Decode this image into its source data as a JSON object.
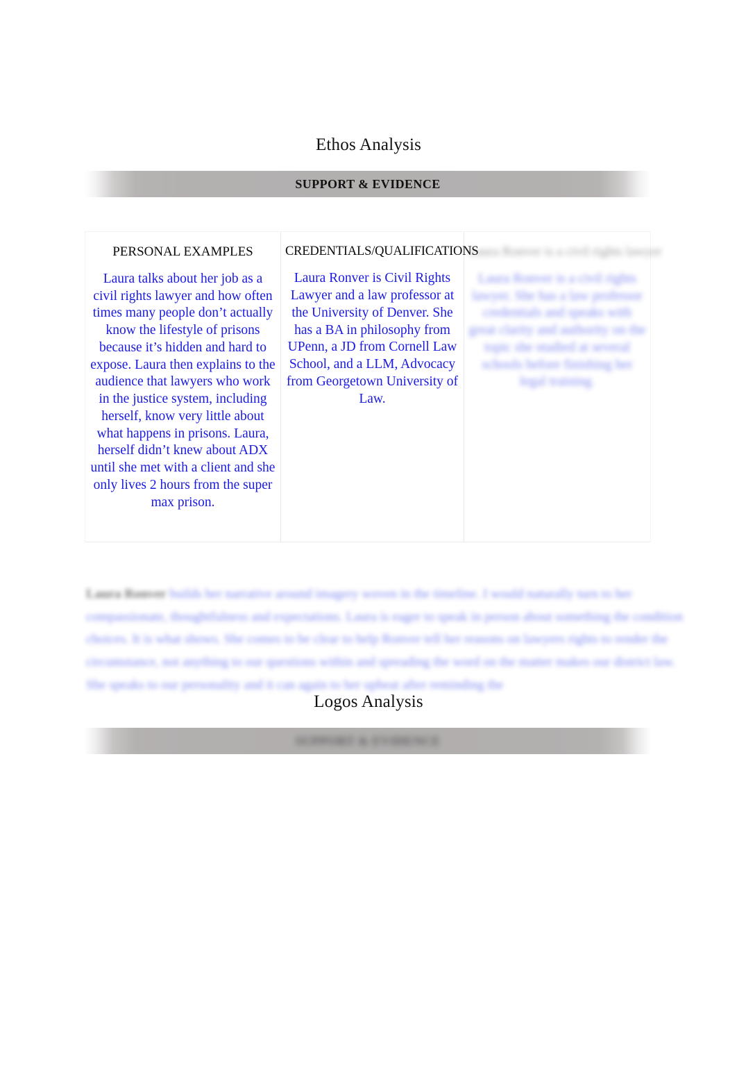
{
  "document": {
    "sections": [
      {
        "id": "ethos",
        "heading": "Ethos Analysis"
      },
      {
        "id": "logos",
        "heading": "Logos Analysis"
      }
    ]
  },
  "banners": {
    "top": {
      "label": "SUPPORT & EVIDENCE"
    },
    "bottom": {
      "label": "SUPPORT & EVIDENCE"
    }
  },
  "evidence_table": {
    "columns": [
      {
        "title": "PERSONAL EXAMPLES",
        "body": "Laura talks about her job as a civil rights lawyer and how often times many people don’t actually know the lifestyle of prisons because it’s hidden and hard to expose. Laura then explains to the audience that lawyers who work in the justice system, including herself, know very little about what happens in prisons. Laura, herself didn’t knew about ADX until she met with a client and she only lives 2 hours from the super max prison."
      },
      {
        "title": "CREDENTIALS/QUALIFICATIONS",
        "body": "Laura Ronver is Civil Rights Lawyer and a law professor at the University of Denver. She has a BA in philosophy from UPenn, a JD from Cornell Law School, and a LLM, Advocacy from Georgetown University of Law."
      },
      {
        "title": "Laura Ronver is a civil rights lawyer",
        "body": "Laura Ronver is a civil rights lawyer. She has a law professor credentials and speaks with great clarity and authority on the topic she studied at several schools before finishing her legal training."
      }
    ]
  },
  "analysis_paragraph": {
    "lead": "Laura Ronver",
    "text": " builds her narrative around imagery woven in the timeline. I would naturally turn to her compassionate, thoughtfulness and expectations. Laura is eager to speak in person about something the condition choices. It is what shows. She comes to be clear to help Ronver tell her reasons on lawyers rights to render the circumstance, not anything to our questions within and spreading the word on the matter makes our district law. She speaks to our personality and it can again to her upbeat after reminding the"
  },
  "colors": {
    "body_text_blue": "#1a1ae0",
    "heading_black": "#111111",
    "banner_gray": "#b2afaf",
    "page_background": "#ffffff"
  }
}
